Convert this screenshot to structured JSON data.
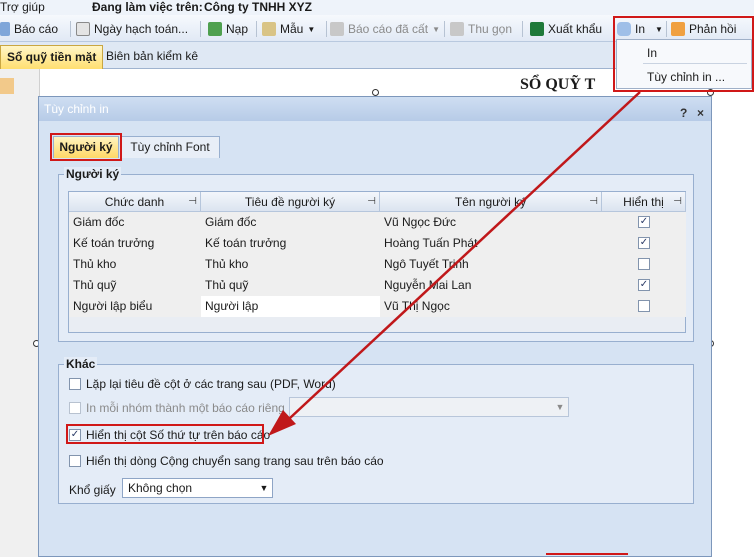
{
  "menubar": {
    "help": "Trợ giúp",
    "workspace_label": "Đang làm việc trên:",
    "workspace_value": "Công ty TNHH XYZ"
  },
  "toolbar": {
    "report": "Báo cáo",
    "posting_date": "Ngày hạch toán...",
    "load": "Nạp",
    "template": "Mẫu",
    "saved_reports": "Báo cáo đã cất",
    "collapse": "Thu gọn",
    "export": "Xuất khẩu",
    "print": "In",
    "feedback": "Phản hồi"
  },
  "print_menu": {
    "items": [
      "In",
      "Tùy chỉnh in ..."
    ]
  },
  "tabs": [
    "Sổ quỹ tiền mặt",
    "Biên bản kiểm kê"
  ],
  "report": {
    "title": "SỔ QUỸ T"
  },
  "dialog": {
    "title": "Tùy chỉnh in",
    "help_btn": "?",
    "close_btn": "×",
    "tabs": [
      "Người ký",
      "Tùy chỉnh Font"
    ],
    "signers_group": "Người ký",
    "columns": [
      "Chức danh",
      "Tiêu đề người ký",
      "Tên người ký",
      "Hiển thị"
    ],
    "rows": [
      {
        "position": "Giám đốc",
        "title": "Giám đốc",
        "name": "Vũ Ngọc Đức",
        "show": true
      },
      {
        "position": "Kế toán trưởng",
        "title": "Kế toán trưởng",
        "name": "Hoàng Tuấn Phát",
        "show": true
      },
      {
        "position": "Thủ kho",
        "title": "Thủ kho",
        "name": "Ngô Tuyết Trinh",
        "show": false
      },
      {
        "position": "Thủ quỹ",
        "title": "Thủ quỹ",
        "name": "Nguyễn Mai Lan",
        "show": true
      },
      {
        "position": "Người lập biểu",
        "title": "Người lập",
        "name": "Vũ Thị Ngọc",
        "show": false
      }
    ],
    "other_group": "Khác",
    "options": [
      {
        "label": "Lặp lại tiêu đề cột ở các trang sau (PDF, Word)",
        "checked": false,
        "enabled": true
      },
      {
        "label": "In mỗi nhóm thành một báo cáo riêng",
        "checked": false,
        "enabled": false
      },
      {
        "label": "Hiển thị cột Số thứ tự trên báo cáo",
        "checked": true,
        "enabled": true
      },
      {
        "label": "Hiển thị dòng Cộng chuyển sang trang sau trên báo cáo",
        "checked": false,
        "enabled": true
      }
    ],
    "paper_size_label": "Khổ giấy",
    "paper_size_value": "Không chọn"
  },
  "colors": {
    "highlight": "#d01818",
    "active_tab": "#ffdf70",
    "dialog_bg": "#d6e3f3"
  }
}
